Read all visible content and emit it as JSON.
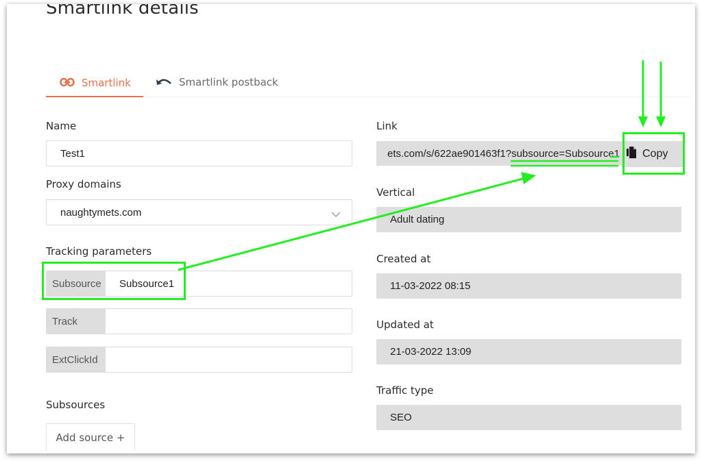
{
  "page": {
    "title": "Smartlink details"
  },
  "tabs": [
    {
      "label": "Smartlink",
      "active": true
    },
    {
      "label": "Smartlink postback",
      "active": false
    }
  ],
  "form": {
    "name_label": "Name",
    "name_value": "Test1",
    "proxy_label": "Proxy domains",
    "proxy_value": "naughtymets.com",
    "tracking_label": "Tracking parameters",
    "params": [
      {
        "name": "Subsource",
        "value": "Subsource1"
      },
      {
        "name": "Track",
        "value": ""
      },
      {
        "name": "ExtClickId",
        "value": ""
      }
    ],
    "subsources_label": "Subsources",
    "add_source_label": "Add source +"
  },
  "details": {
    "link_label": "Link",
    "link_value": "ets.com/s/622ae901463f1?subsource=Subsource1",
    "copy_label": "Copy",
    "vertical_label": "Vertical",
    "vertical_value": "Adult dating",
    "created_label": "Created at",
    "created_value": "11-03-2022 08:15",
    "updated_label": "Updated at",
    "updated_value": "21-03-2022 13:09",
    "traffic_label": "Traffic type",
    "traffic_value": "SEO"
  },
  "colors": {
    "accent": "#e8704b",
    "annotation": "#22ee22",
    "readonly_bg": "#dedede"
  },
  "icons": {
    "tab_smartlink": "link-icon",
    "tab_postback": "undo-arrow-icon",
    "copy": "copy-document-icon",
    "select": "chevron-down-icon"
  }
}
